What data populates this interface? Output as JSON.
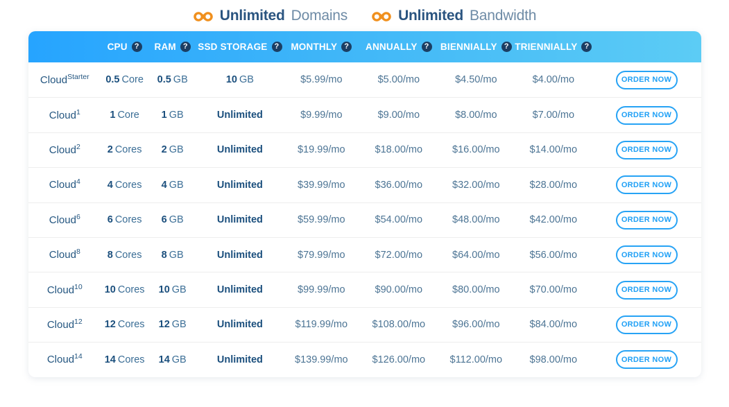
{
  "banner": {
    "items": [
      {
        "icon": "infinity-icon",
        "strong": "Unlimited",
        "light": "Domains"
      },
      {
        "icon": "infinity-icon",
        "strong": "Unlimited",
        "light": "Bandwidth"
      }
    ]
  },
  "colors": {
    "header_gradient_start": "#26A4FF",
    "header_gradient_end": "#5CCCF5",
    "accent_blue": "#1FA0F6",
    "infinity_orange": "#F0901E",
    "plan_text": "#245680",
    "price_text": "#4C7494",
    "help_icon_bg": "#1B3E63",
    "row_divider": "#EDEDED"
  },
  "table": {
    "columns": [
      {
        "key": "plan",
        "label": "",
        "help": false
      },
      {
        "key": "cpu",
        "label": "CPU",
        "help": true,
        "help_glyph": "?"
      },
      {
        "key": "ram",
        "label": "RAM",
        "help": true,
        "help_glyph": "?"
      },
      {
        "key": "ssd",
        "label": "SSD STORAGE",
        "help": true,
        "help_glyph": "?"
      },
      {
        "key": "monthly",
        "label": "MONTHLY",
        "help": true,
        "help_glyph": "?"
      },
      {
        "key": "annually",
        "label": "ANNUALLY",
        "help": true,
        "help_glyph": "?"
      },
      {
        "key": "biennially",
        "label": "BIENNIALLY",
        "help": true,
        "help_glyph": "?"
      },
      {
        "key": "triennially",
        "label": "TRIENNIALLY",
        "help": true,
        "help_glyph": "?"
      },
      {
        "key": "action",
        "label": "",
        "help": false
      }
    ],
    "order_button_label": "ORDER NOW",
    "rows": [
      {
        "plan_base": "Cloud",
        "plan_sup": "Starter",
        "cpu_num": "0.5",
        "cpu_unit": "Core",
        "ram_num": "0.5",
        "ram_unit": "GB",
        "ssd_num": "10",
        "ssd_unit": "GB",
        "ssd_text": "",
        "monthly": "$5.99/mo",
        "annually": "$5.00/mo",
        "biennially": "$4.50/mo",
        "triennially": "$4.00/mo"
      },
      {
        "plan_base": "Cloud",
        "plan_sup": "1",
        "cpu_num": "1",
        "cpu_unit": "Core",
        "ram_num": "1",
        "ram_unit": "GB",
        "ssd_num": "",
        "ssd_unit": "",
        "ssd_text": "Unlimited",
        "monthly": "$9.99/mo",
        "annually": "$9.00/mo",
        "biennially": "$8.00/mo",
        "triennially": "$7.00/mo"
      },
      {
        "plan_base": "Cloud",
        "plan_sup": "2",
        "cpu_num": "2",
        "cpu_unit": "Cores",
        "ram_num": "2",
        "ram_unit": "GB",
        "ssd_num": "",
        "ssd_unit": "",
        "ssd_text": "Unlimited",
        "monthly": "$19.99/mo",
        "annually": "$18.00/mo",
        "biennially": "$16.00/mo",
        "triennially": "$14.00/mo"
      },
      {
        "plan_base": "Cloud",
        "plan_sup": "4",
        "cpu_num": "4",
        "cpu_unit": "Cores",
        "ram_num": "4",
        "ram_unit": "GB",
        "ssd_num": "",
        "ssd_unit": "",
        "ssd_text": "Unlimited",
        "monthly": "$39.99/mo",
        "annually": "$36.00/mo",
        "biennially": "$32.00/mo",
        "triennially": "$28.00/mo"
      },
      {
        "plan_base": "Cloud",
        "plan_sup": "6",
        "cpu_num": "6",
        "cpu_unit": "Cores",
        "ram_num": "6",
        "ram_unit": "GB",
        "ssd_num": "",
        "ssd_unit": "",
        "ssd_text": "Unlimited",
        "monthly": "$59.99/mo",
        "annually": "$54.00/mo",
        "biennially": "$48.00/mo",
        "triennially": "$42.00/mo"
      },
      {
        "plan_base": "Cloud",
        "plan_sup": "8",
        "cpu_num": "8",
        "cpu_unit": "Cores",
        "ram_num": "8",
        "ram_unit": "GB",
        "ssd_num": "",
        "ssd_unit": "",
        "ssd_text": "Unlimited",
        "monthly": "$79.99/mo",
        "annually": "$72.00/mo",
        "biennially": "$64.00/mo",
        "triennially": "$56.00/mo"
      },
      {
        "plan_base": "Cloud",
        "plan_sup": "10",
        "cpu_num": "10",
        "cpu_unit": "Cores",
        "ram_num": "10",
        "ram_unit": "GB",
        "ssd_num": "",
        "ssd_unit": "",
        "ssd_text": "Unlimited",
        "monthly": "$99.99/mo",
        "annually": "$90.00/mo",
        "biennially": "$80.00/mo",
        "triennially": "$70.00/mo"
      },
      {
        "plan_base": "Cloud",
        "plan_sup": "12",
        "cpu_num": "12",
        "cpu_unit": "Cores",
        "ram_num": "12",
        "ram_unit": "GB",
        "ssd_num": "",
        "ssd_unit": "",
        "ssd_text": "Unlimited",
        "monthly": "$119.99/mo",
        "annually": "$108.00/mo",
        "biennially": "$96.00/mo",
        "triennially": "$84.00/mo"
      },
      {
        "plan_base": "Cloud",
        "plan_sup": "14",
        "cpu_num": "14",
        "cpu_unit": "Cores",
        "ram_num": "14",
        "ram_unit": "GB",
        "ssd_num": "",
        "ssd_unit": "",
        "ssd_text": "Unlimited",
        "monthly": "$139.99/mo",
        "annually": "$126.00/mo",
        "biennially": "$112.00/mo",
        "triennially": "$98.00/mo"
      }
    ]
  }
}
